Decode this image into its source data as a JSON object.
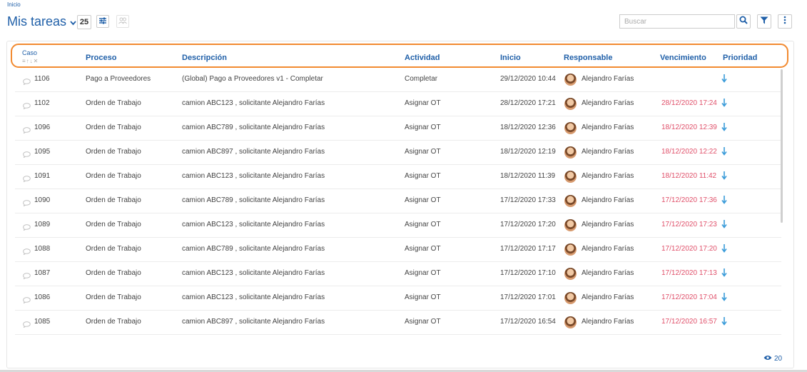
{
  "breadcrumb": "Inicio",
  "page": {
    "title": "Mis tareas",
    "count": "25"
  },
  "search": {
    "placeholder": "Buscar"
  },
  "colors": {
    "accent": "#1f5fa8",
    "highlight": "#f28a30",
    "overdue": "#e0506a",
    "priority": "#3a9bd9"
  },
  "icons": {
    "title_dropdown": "chevron-down-icon",
    "filter_settings": "sliders-icon",
    "group": "group-icon",
    "search": "search-icon",
    "filter": "filter-icon",
    "more": "more-vertical-icon",
    "comment": "comment-icon",
    "priority": "arrow-down-icon",
    "views": "eye-icon"
  },
  "table": {
    "columns": {
      "caso": "Caso",
      "proceso": "Proceso",
      "descripcion": "Descripción",
      "actividad": "Actividad",
      "inicio": "Inicio",
      "responsable": "Responsable",
      "vencimiento": "Vencimiento",
      "prioridad": "Prioridad"
    },
    "rows": [
      {
        "caso": "1106",
        "proceso": "Pago a Proveedores",
        "descripcion": "(Global) Pago a Proveedores v1 - Completar",
        "actividad": "Completar",
        "inicio": "29/12/2020 10:44",
        "responsable": "Alejandro Farías",
        "vencimiento": ""
      },
      {
        "caso": "1102",
        "proceso": "Orden de Trabajo",
        "descripcion": "camion ABC123 , solicitante Alejandro Farías",
        "actividad": "Asignar OT",
        "inicio": "28/12/2020 17:21",
        "responsable": "Alejandro Farías",
        "vencimiento": "28/12/2020 17:24"
      },
      {
        "caso": "1096",
        "proceso": "Orden de Trabajo",
        "descripcion": "camion ABC789 , solicitante Alejandro Farías",
        "actividad": "Asignar OT",
        "inicio": "18/12/2020 12:36",
        "responsable": "Alejandro Farías",
        "vencimiento": "18/12/2020 12:39"
      },
      {
        "caso": "1095",
        "proceso": "Orden de Trabajo",
        "descripcion": "camion ABC897 , solicitante Alejandro Farías",
        "actividad": "Asignar OT",
        "inicio": "18/12/2020 12:19",
        "responsable": "Alejandro Farías",
        "vencimiento": "18/12/2020 12:22"
      },
      {
        "caso": "1091",
        "proceso": "Orden de Trabajo",
        "descripcion": "camion ABC123 , solicitante Alejandro Farías",
        "actividad": "Asignar OT",
        "inicio": "18/12/2020 11:39",
        "responsable": "Alejandro Farías",
        "vencimiento": "18/12/2020 11:42"
      },
      {
        "caso": "1090",
        "proceso": "Orden de Trabajo",
        "descripcion": "camion ABC789 , solicitante Alejandro Farías",
        "actividad": "Asignar OT",
        "inicio": "17/12/2020 17:33",
        "responsable": "Alejandro Farías",
        "vencimiento": "17/12/2020 17:36"
      },
      {
        "caso": "1089",
        "proceso": "Orden de Trabajo",
        "descripcion": "camion ABC123 , solicitante Alejandro Farías",
        "actividad": "Asignar OT",
        "inicio": "17/12/2020 17:20",
        "responsable": "Alejandro Farías",
        "vencimiento": "17/12/2020 17:23"
      },
      {
        "caso": "1088",
        "proceso": "Orden de Trabajo",
        "descripcion": "camion ABC789 , solicitante Alejandro Farías",
        "actividad": "Asignar OT",
        "inicio": "17/12/2020 17:17",
        "responsable": "Alejandro Farías",
        "vencimiento": "17/12/2020 17:20"
      },
      {
        "caso": "1087",
        "proceso": "Orden de Trabajo",
        "descripcion": "camion ABC123 , solicitante Alejandro Farías",
        "actividad": "Asignar OT",
        "inicio": "17/12/2020 17:10",
        "responsable": "Alejandro Farías",
        "vencimiento": "17/12/2020 17:13"
      },
      {
        "caso": "1086",
        "proceso": "Orden de Trabajo",
        "descripcion": "camion ABC123 , solicitante Alejandro Farías",
        "actividad": "Asignar OT",
        "inicio": "17/12/2020 17:01",
        "responsable": "Alejandro Farías",
        "vencimiento": "17/12/2020 17:04"
      },
      {
        "caso": "1085",
        "proceso": "Orden de Trabajo",
        "descripcion": "camion ABC897 , solicitante Alejandro Farías",
        "actividad": "Asignar OT",
        "inicio": "17/12/2020 16:54",
        "responsable": "Alejandro Farías",
        "vencimiento": "17/12/2020 16:57"
      }
    ]
  },
  "footer": {
    "views": "20"
  }
}
